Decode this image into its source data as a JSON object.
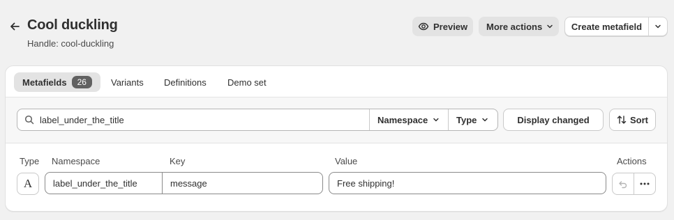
{
  "header": {
    "title": "Cool duckling",
    "handle": "Handle: cool-duckling",
    "back_icon": "arrow-left-icon",
    "preview_label": "Preview",
    "more_actions_label": "More actions",
    "create_label": "Create metafield"
  },
  "tabs": [
    {
      "label": "Metafields",
      "badge": "26",
      "active": true
    },
    {
      "label": "Variants"
    },
    {
      "label": "Definitions"
    },
    {
      "label": "Demo set"
    }
  ],
  "filters": {
    "search_value": "label_under_the_title",
    "namespace_label": "Namespace",
    "type_label": "Type",
    "display_changed_label": "Display changed",
    "sort_label": "Sort"
  },
  "table": {
    "headers": {
      "type": "Type",
      "namespace": "Namespace",
      "key": "Key",
      "value": "Value",
      "actions": "Actions"
    },
    "rows": [
      {
        "type_glyph": "A",
        "namespace": "label_under_the_title",
        "key": "message",
        "value": "Free shipping!"
      }
    ]
  },
  "colors": {
    "background": "#f1f1f1",
    "card": "#ffffff",
    "badge": "#616161",
    "secondary_button": "#e3e3e3"
  }
}
